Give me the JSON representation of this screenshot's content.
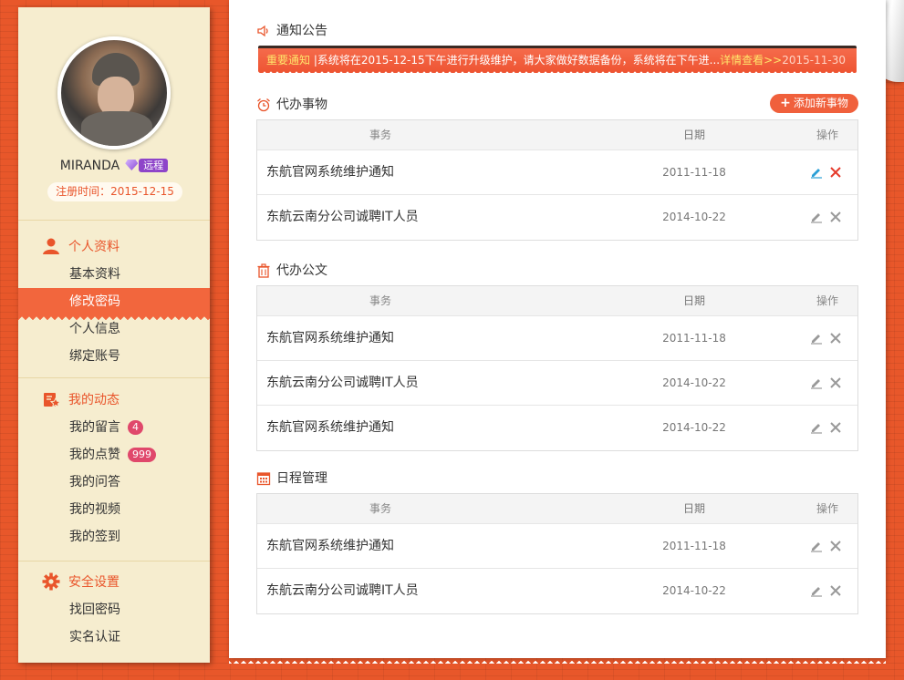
{
  "sidebar": {
    "username": "MIRANDA",
    "level": "远程",
    "reg_time": "注册时间：2015-12-15",
    "groups": [
      {
        "title": "个人资料",
        "icon": "user-icon",
        "items": [
          {
            "label": "基本资料"
          },
          {
            "label": "修改密码",
            "active": true
          },
          {
            "label": "个人信息"
          },
          {
            "label": "绑定账号"
          }
        ]
      },
      {
        "title": "我的动态",
        "icon": "activity-icon",
        "items": [
          {
            "label": "我的留言",
            "badge": "4"
          },
          {
            "label": "我的点赞",
            "badge": "999"
          },
          {
            "label": "我的问答"
          },
          {
            "label": "我的视频"
          },
          {
            "label": "我的签到"
          }
        ]
      },
      {
        "title": "安全设置",
        "icon": "gear-icon",
        "items": [
          {
            "label": "找回密码"
          },
          {
            "label": "实名认证"
          }
        ]
      }
    ]
  },
  "notice": {
    "title": "通知公告",
    "tag": "重要通知",
    "separator": "|",
    "text": "系统将在2015-12-15下午进行升级维护，请大家做好数据备份，系统将在下午进...",
    "more": "详情查看>>",
    "date": "2015-11-30"
  },
  "sections": [
    {
      "title": "代办事物",
      "icon": "alarm-clock-icon",
      "add_label": "添加新事物",
      "header": {
        "task": "事务",
        "date": "日期",
        "op": "操作"
      },
      "rows": [
        {
          "task": "东航官网系统维护通知",
          "date": "2011-11-18",
          "highlight": true
        },
        {
          "task": "东航云南分公司诚聘IT人员",
          "date": "2014-10-22"
        }
      ]
    },
    {
      "title": "代办公文",
      "icon": "trash-icon",
      "header": {
        "task": "事务",
        "date": "日期",
        "op": "操作"
      },
      "rows": [
        {
          "task": "东航官网系统维护通知",
          "date": "2011-11-18"
        },
        {
          "task": "东航云南分公司诚聘IT人员",
          "date": "2014-10-22"
        },
        {
          "task": "东航官网系统维护通知",
          "date": "2014-10-22"
        }
      ]
    },
    {
      "title": "日程管理",
      "icon": "calendar-icon",
      "header": {
        "task": "事务",
        "date": "日期",
        "op": "操作"
      },
      "rows": [
        {
          "task": "东航官网系统维护通知",
          "date": "2011-11-18"
        },
        {
          "task": "东航云南分公司诚聘IT人员",
          "date": "2014-10-22"
        }
      ]
    }
  ],
  "colors": {
    "accent": "#e9552b",
    "sidebar_bg": "#f6edcf",
    "badge": "#e0486b",
    "edit_active": "#2a9fd6",
    "delete_active": "#e53a2b",
    "icon_gray": "#999999"
  }
}
